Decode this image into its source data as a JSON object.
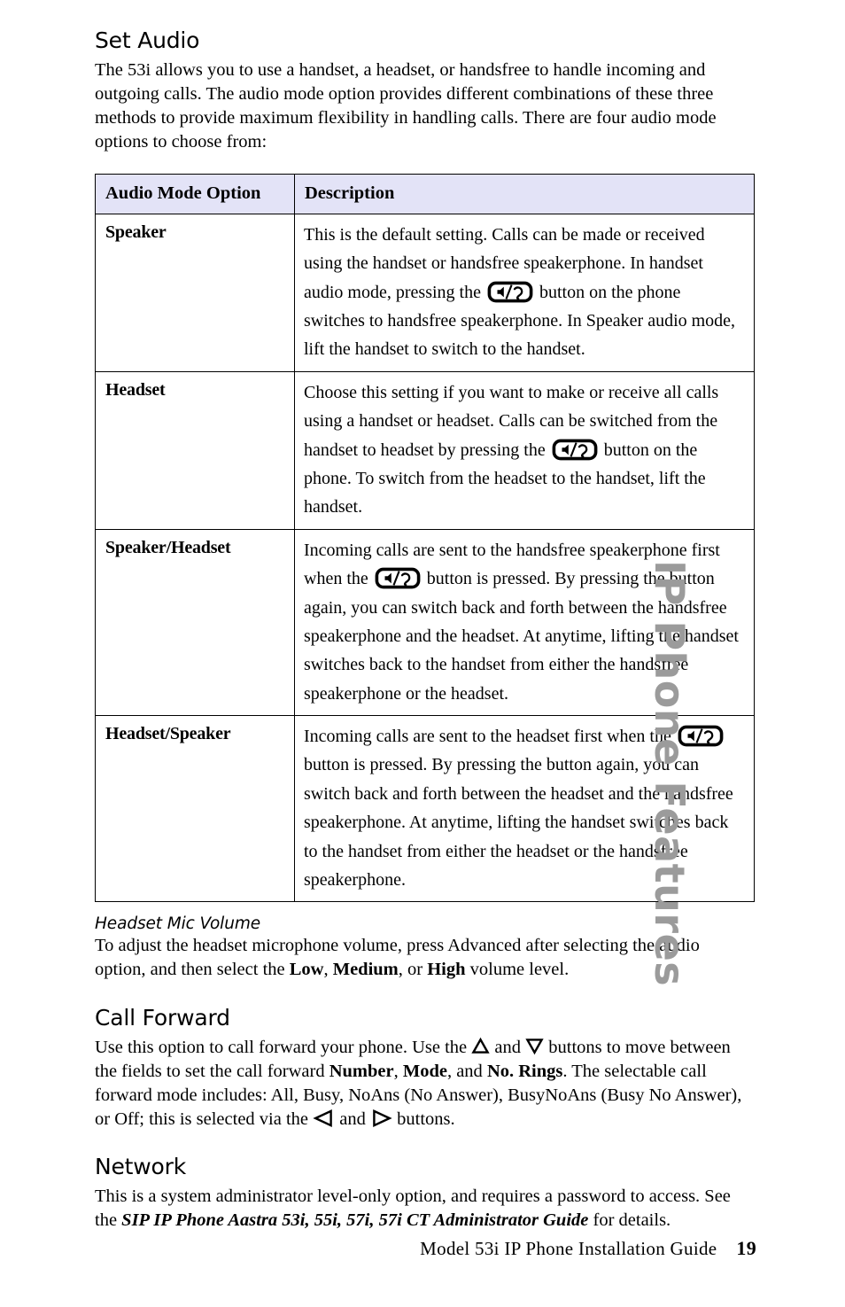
{
  "page": {
    "side_tab_label": "IP Phone Features",
    "side_tab_color": "#9b9b9b",
    "footer": {
      "guide_title": "Model 53i IP Phone Installation Guide",
      "page_number": "19"
    }
  },
  "sections": {
    "set_audio": {
      "heading": "Set Audio",
      "intro": "The 53i allows you to use a handset, a headset, or handsfree to handle incoming and outgoing calls. The audio mode option provides different combinations of these three methods to provide maximum flexibility in handling calls. There are four audio mode options to choose from:"
    },
    "headset_mic_volume": {
      "heading": "Headset Mic Volume",
      "text_1": "To adjust the headset microphone volume, press Advanced after selecting the audio option, and then select the ",
      "opt_low": "Low",
      "sep_1": ", ",
      "opt_medium": "Medium",
      "sep_2": ", or ",
      "opt_high": "High",
      "text_2": " volume level."
    },
    "call_forward": {
      "heading": "Call Forward",
      "text_1": "Use this option to call forward your phone. Use the ",
      "text_and_1": " and ",
      "text_2": " buttons to move between the fields to set the call forward ",
      "field_number": "Number",
      "sep_1": ", ",
      "field_mode": "Mode",
      "sep_2": ", and ",
      "field_no_rings": "No. Rings",
      "text_3": ". The selectable call forward mode includes: All, Busy, NoAns (No Answer), BusyNoAns (Busy No Answer), or Off; this is selected via the ",
      "text_and_2": " and ",
      "text_4": " buttons."
    },
    "network": {
      "heading": "Network",
      "text_1": "This is a system administrator level-only option, and requires a password to access. See the ",
      "guide_ref": "SIP IP Phone Aastra 53i, 55i, 57i, 57i CT Administrator Guide",
      "text_2": " for details."
    }
  },
  "audio_table": {
    "header_bg": "#e3e3f7",
    "columns": [
      "Audio Mode Option",
      "Description"
    ],
    "rows": [
      {
        "option": "Speaker",
        "desc_1": "This is the default setting. Calls can be made or received using the handset or handsfree speakerphone. In handset audio mode, pressing the ",
        "icon": "speaker-headset-key-icon",
        "desc_2": " button on the phone switches to handsfree speakerphone. In Speaker audio mode, lift the handset to switch to the handset."
      },
      {
        "option": "Headset",
        "desc_1": "Choose this setting if you want to make or receive all calls using a handset or headset. Calls can be switched from the handset to headset by pressing the ",
        "icon": "speaker-headset-key-icon",
        "desc_2": " button on the phone. To switch from the headset to the handset, lift the handset."
      },
      {
        "option": "Speaker/Headset",
        "desc_1": " Incoming calls are sent to the handsfree speakerphone first when the ",
        "icon": "speaker-headset-key-icon",
        "desc_2": " button is pressed. By pressing the button again, you can switch back and forth between the handsfree speakerphone and the headset. At anytime, lifting the handset switches back to the handset from either the handsfree speakerphone or the headset."
      },
      {
        "option": "Headset/Speaker",
        "desc_1": "Incoming calls are sent to the headset first when the ",
        "icon": "speaker-headset-key-icon",
        "desc_2": " button is pressed. By pressing the button again, you can switch back and forth between the headset and the handsfree speakerphone. At anytime, lifting the handset switches back to the handset from either the headset or the handsfree speakerphone."
      }
    ]
  }
}
